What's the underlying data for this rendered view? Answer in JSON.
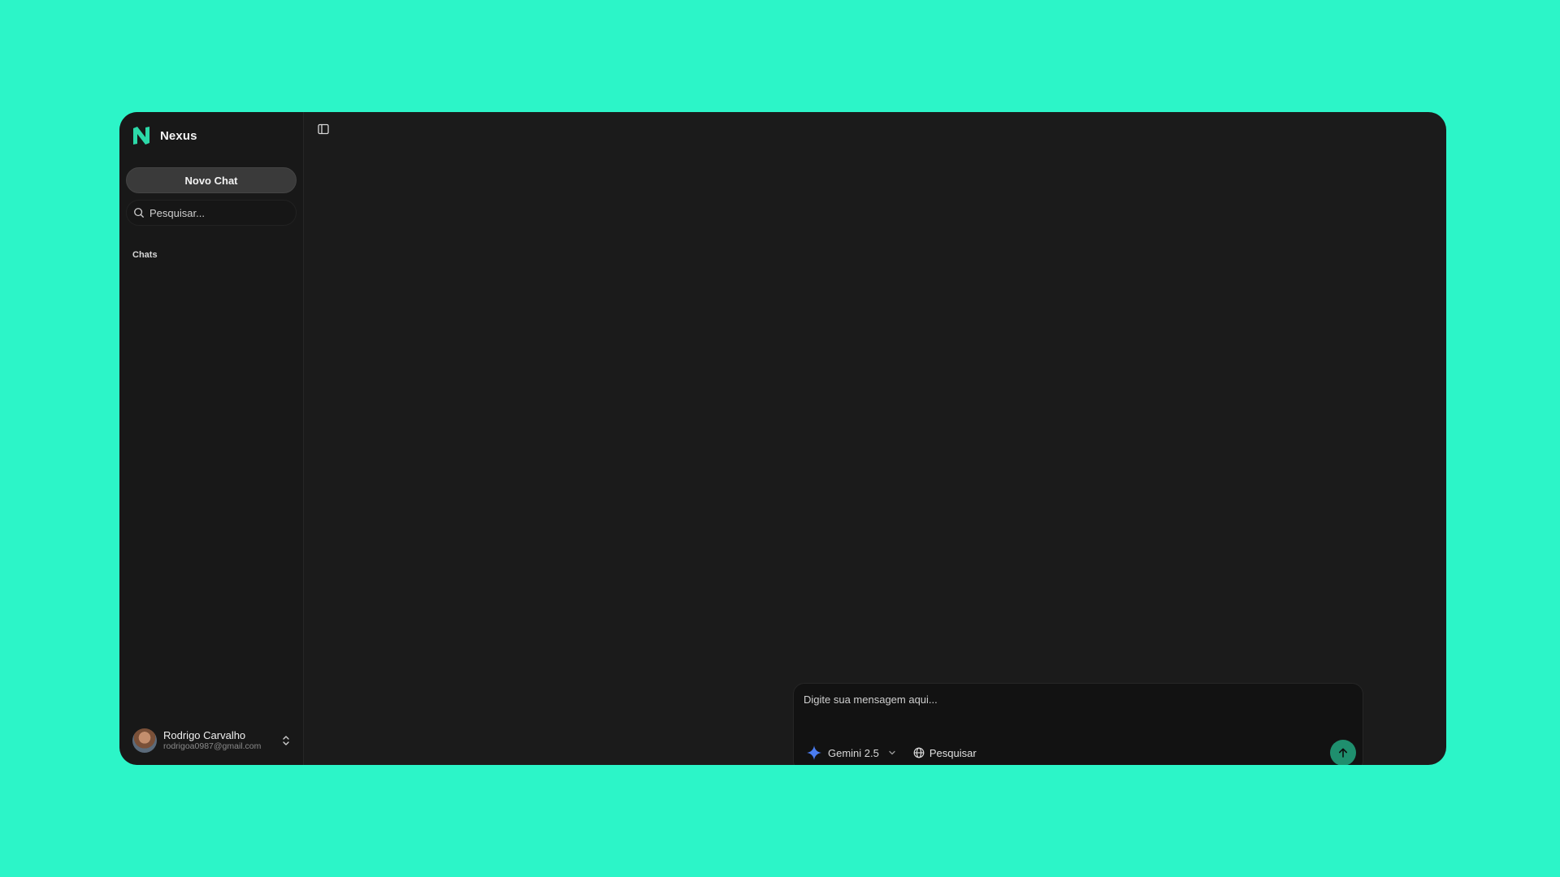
{
  "app": {
    "name": "Nexus"
  },
  "sidebar": {
    "new_chat_label": "Novo Chat",
    "search_placeholder": "Pesquisar...",
    "section_label": "Chats"
  },
  "user": {
    "name": "Rodrigo Carvalho",
    "email": "rodrigoa0987@gmail.com"
  },
  "composer": {
    "placeholder": "Digite sua mensagem aqui...",
    "model_label": "Gemini 2.5",
    "search_label": "Pesquisar"
  },
  "icons": {
    "logo": "nexus-logo-icon",
    "search": "search-icon",
    "expand": "chevron-up-down-icon",
    "toggle": "sidebar-toggle-icon",
    "model": "sparkle-icon",
    "dropdown": "chevron-down-icon",
    "globe": "globe-icon",
    "send": "arrow-up-icon"
  },
  "colors": {
    "background": "#2cf5c8",
    "window": "#1b1b1b",
    "sidebar": "#181818",
    "accent": "#1f8f6e",
    "logo": "#2cd9a8",
    "sparkle": "#4a7cf0"
  }
}
